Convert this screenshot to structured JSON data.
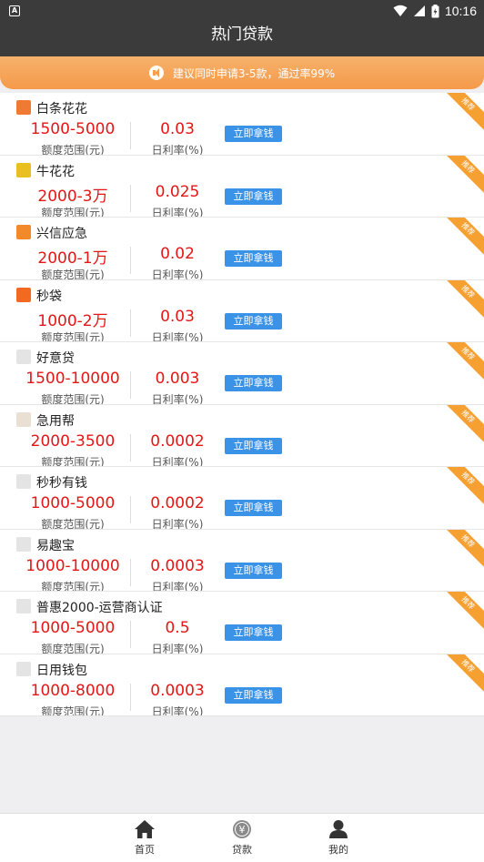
{
  "status_bar": {
    "time": "10:16",
    "notification_glyph": "A"
  },
  "title_bar": {
    "title": "热门贷款"
  },
  "banner": {
    "text": "建议同时申请3-5款，通过率99%"
  },
  "common": {
    "amount_label": "额度范围(元)",
    "rate_label": "日利率(%)",
    "apply_label": "立即拿钱",
    "tag_label": "推荐"
  },
  "loans": [
    {
      "name": "白条花花",
      "amount": "1500-5000",
      "rate": "0.03",
      "logo_color": "#f07a33"
    },
    {
      "name": "牛花花",
      "amount": "2000-3万",
      "rate": "0.025",
      "logo_color": "#e9c021"
    },
    {
      "name": "兴信应急",
      "amount": "2000-1万",
      "rate": "0.02",
      "logo_color": "#f28a2a"
    },
    {
      "name": "秒袋",
      "amount": "1000-2万",
      "rate": "0.03",
      "logo_color": "#f26a1f"
    },
    {
      "name": "好意贷",
      "amount": "1500-10000",
      "rate": "0.003",
      "logo_color": "#e4e4e4"
    },
    {
      "name": "急用帮",
      "amount": "2000-3500",
      "rate": "0.0002",
      "logo_color": "#eadfd3"
    },
    {
      "name": "秒秒有钱",
      "amount": "1000-5000",
      "rate": "0.0002",
      "logo_color": "#e4e4e4"
    },
    {
      "name": "易趣宝",
      "amount": "1000-10000",
      "rate": "0.0003",
      "logo_color": "#e4e4e4"
    },
    {
      "name": "普惠2000-运营商认证",
      "amount": "1000-5000",
      "rate": "0.5",
      "logo_color": "#e4e4e4"
    },
    {
      "name": "日用钱包",
      "amount": "1000-8000",
      "rate": "0.0003",
      "logo_color": "#e4e4e4"
    }
  ],
  "tab_bar": {
    "tabs": [
      {
        "label": "首页",
        "icon": "home-icon"
      },
      {
        "label": "贷款",
        "icon": "yuan-coin-icon",
        "glyph": "¥"
      },
      {
        "label": "我的",
        "icon": "user-icon"
      }
    ]
  }
}
